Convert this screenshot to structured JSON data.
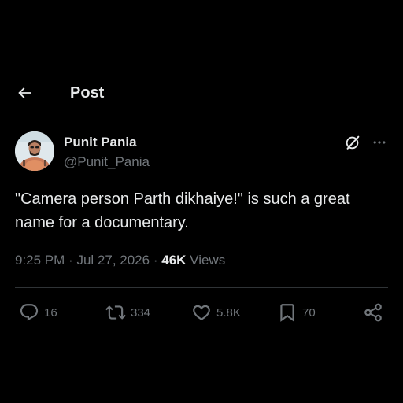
{
  "header": {
    "title": "Post",
    "back_icon": "arrow-left-icon"
  },
  "post": {
    "author": {
      "name": "Punit Pania",
      "handle": "@Punit_Pania"
    },
    "text": "\"Camera person Parth dikhaiye!\" is such a great name for a documentary.",
    "time": "9:25 PM",
    "date": "Jul 27, 2026",
    "separator": "·",
    "views_count": "46K",
    "views_label": "Views"
  },
  "actions": {
    "replies": "16",
    "reposts": "334",
    "likes": "5.8K",
    "bookmarks": "70"
  },
  "colors": {
    "background": "#000000",
    "text_primary": "#e7e9ea",
    "text_secondary": "#71767b",
    "divider": "#2f3336"
  },
  "icons": [
    "arrow-left-icon",
    "grok-icon",
    "more-icon",
    "reply-icon",
    "repost-icon",
    "like-icon",
    "bookmark-icon",
    "share-icon"
  ]
}
